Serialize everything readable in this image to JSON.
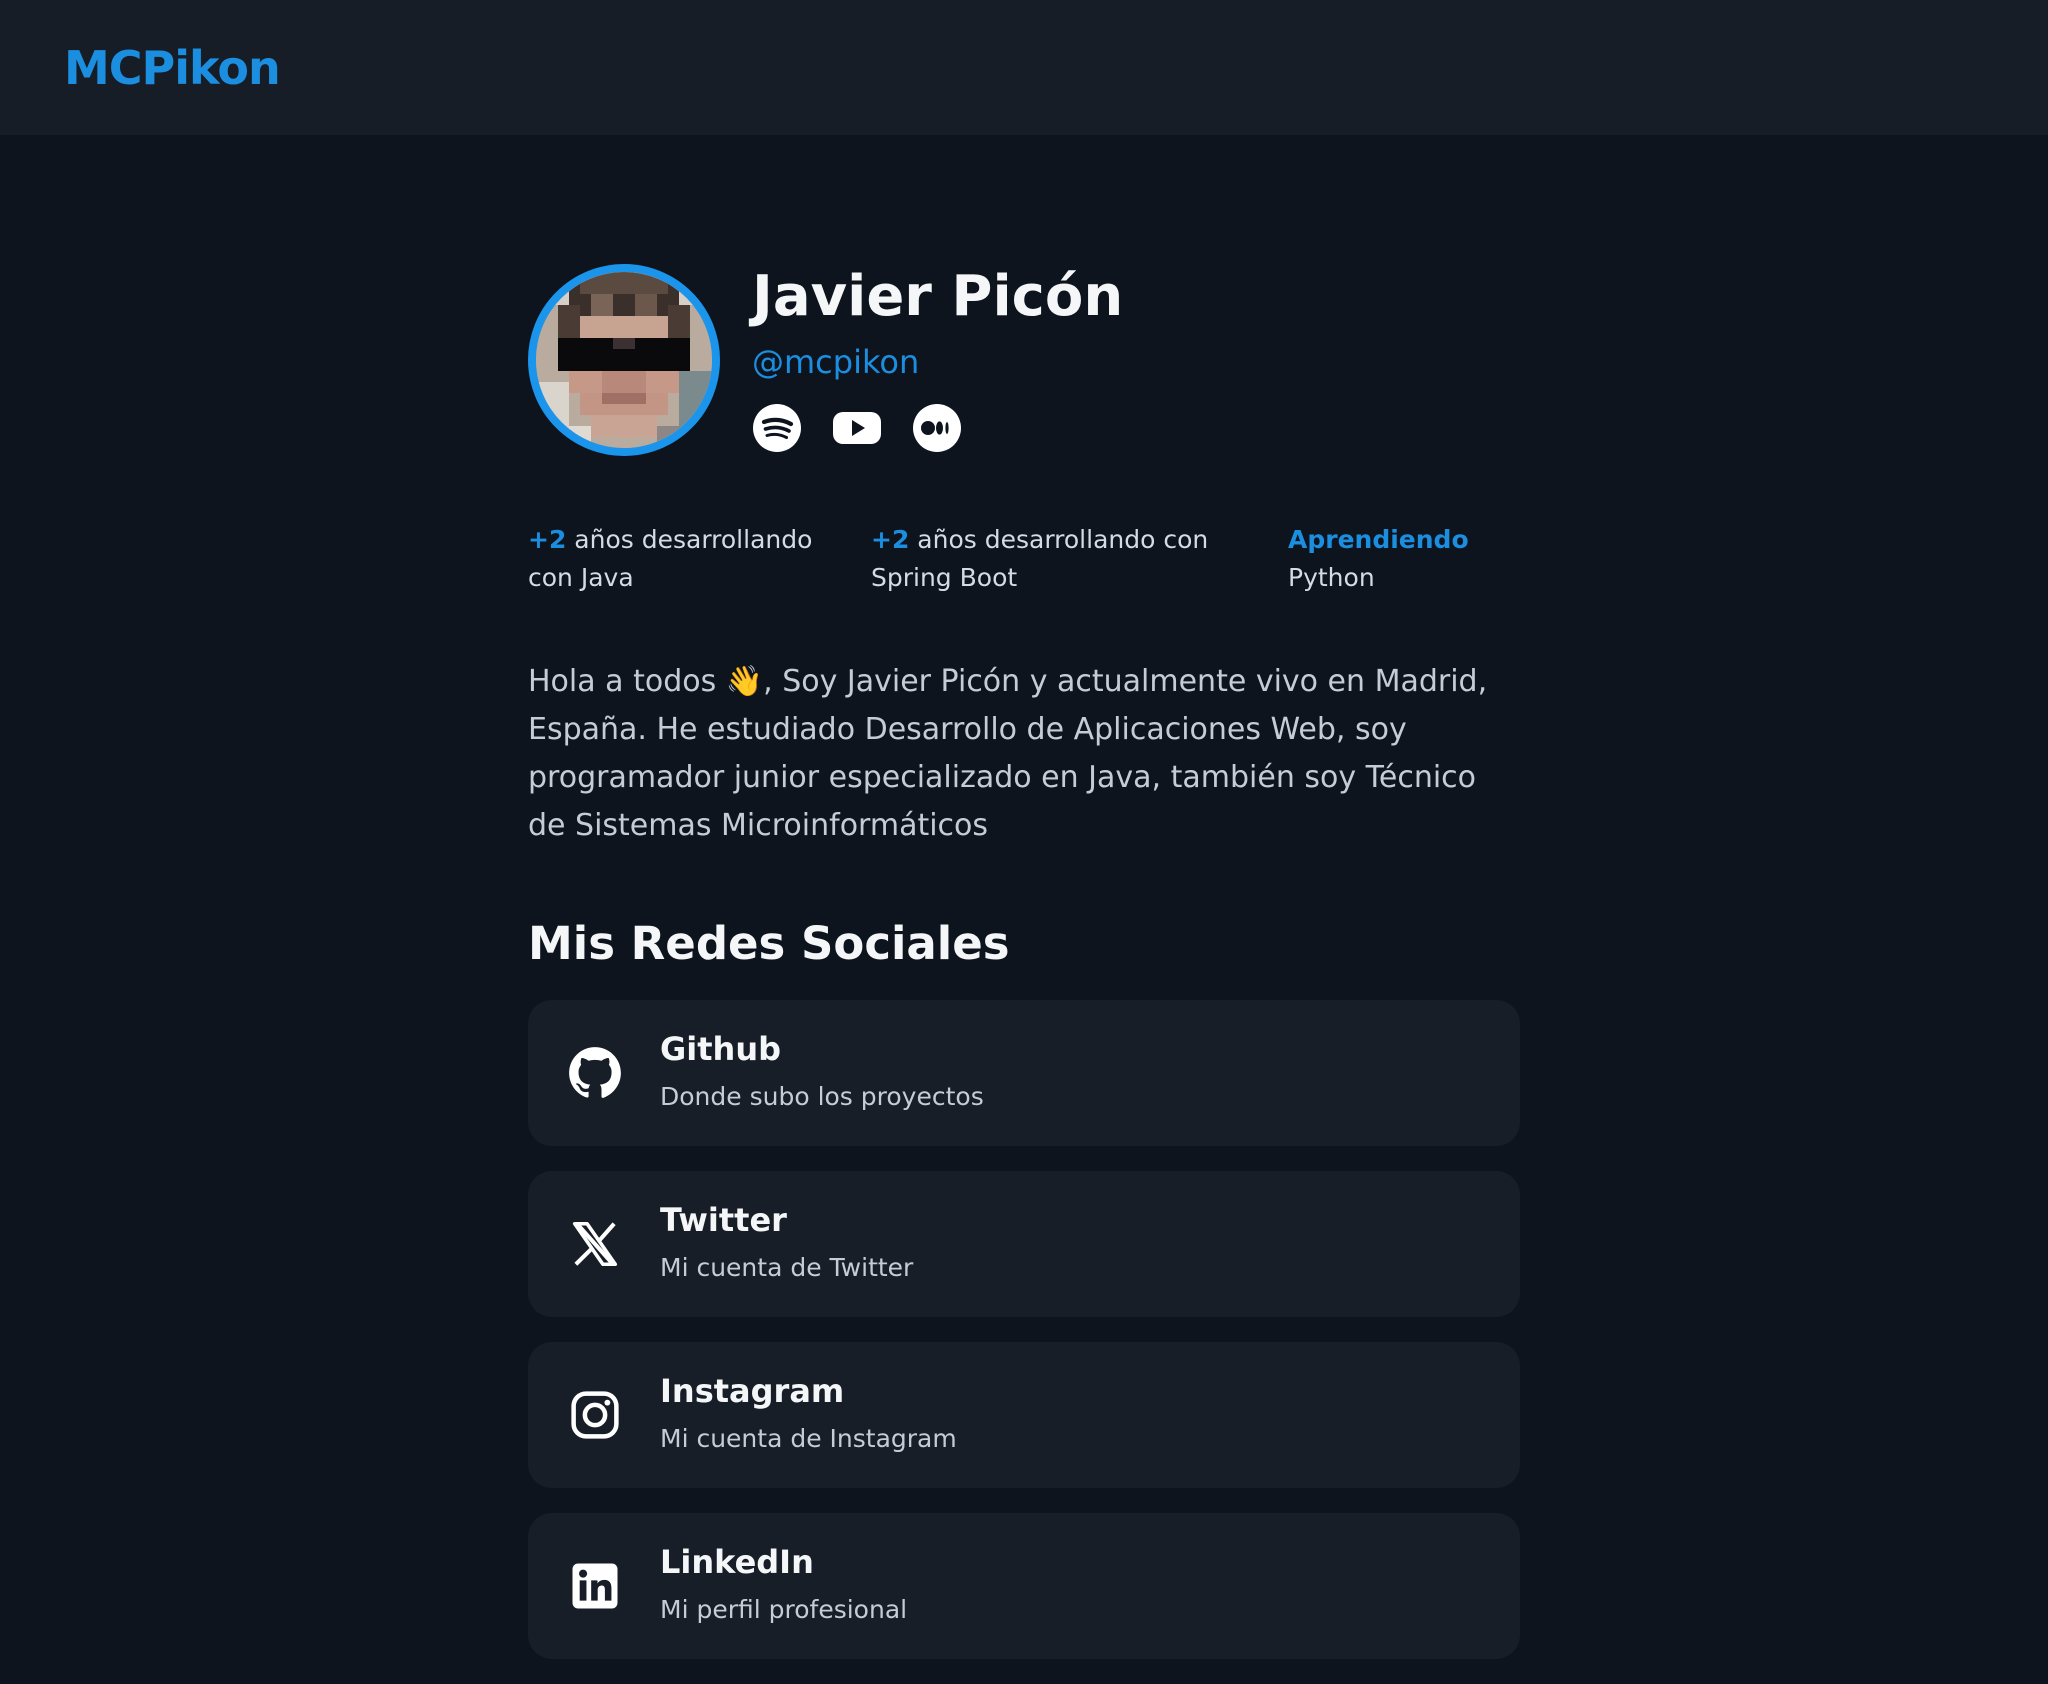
{
  "header": {
    "logo": "MCPikon"
  },
  "profile": {
    "name": "Javier Picón",
    "handle": "@mcpikon",
    "icons": [
      "spotify-icon",
      "youtube-icon",
      "medium-icon"
    ]
  },
  "stats": [
    {
      "strong": "+2",
      "text": " años desarrollando con Java"
    },
    {
      "strong": "+2",
      "text": " años desarrollando con Spring Boot"
    },
    {
      "strong": "Aprendiendo",
      "text": " Python"
    }
  ],
  "bio": {
    "before": "Hola a todos ",
    "emoji": "👋",
    "after": ", Soy Javier Picón y actualmente vivo en Madrid, España. He estudiado Desarrollo de Aplicaciones Web, soy programador junior especializado en Java, también soy Técnico de Sistemas Microinformáticos"
  },
  "social": {
    "title": "Mis Redes Sociales",
    "items": [
      {
        "title": "Github",
        "subtitle": "Donde subo los proyectos",
        "icon": "github-icon"
      },
      {
        "title": "Twitter",
        "subtitle": "Mi cuenta de Twitter",
        "icon": "x-twitter-icon"
      },
      {
        "title": "Instagram",
        "subtitle": "Mi cuenta de Instagram",
        "icon": "instagram-icon"
      },
      {
        "title": "LinkedIn",
        "subtitle": "Mi perfil profesional",
        "icon": "linkedin-icon"
      }
    ]
  },
  "colors": {
    "accent": "#1b8ee0",
    "background": "#0d141d",
    "header": "#161d26",
    "card": "#171e27"
  }
}
